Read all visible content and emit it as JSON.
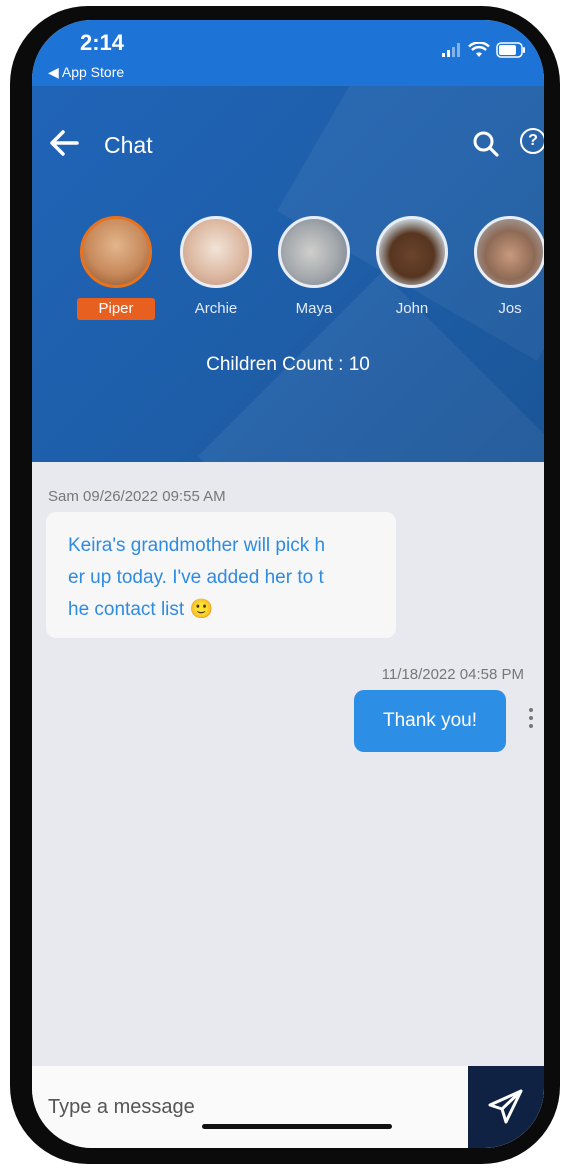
{
  "status_bar": {
    "time": "2:14",
    "back_app": "◀ App Store"
  },
  "header": {
    "title": "Chat",
    "children_count": "Children Count : 10"
  },
  "children": [
    {
      "name": "Piper",
      "selected": true,
      "avatar_colors": [
        "#d9a77a",
        "#a05b2c"
      ]
    },
    {
      "name": "Archie",
      "selected": false,
      "avatar_colors": [
        "#e7d7c9",
        "#c99b84"
      ]
    },
    {
      "name": "Maya",
      "selected": false,
      "avatar_colors": [
        "#b7b7b5",
        "#6e7d8f"
      ]
    },
    {
      "name": "John",
      "selected": false,
      "avatar_colors": [
        "#d8e3ea",
        "#5a3a25"
      ]
    },
    {
      "name": "Jos",
      "selected": false,
      "avatar_colors": [
        "#a9b6c6",
        "#7b5a45"
      ]
    }
  ],
  "messages": [
    {
      "direction": "incoming",
      "meta": "Sam 09/26/2022 09:55 AM",
      "lines": [
        "Keira's grandmother will pick h",
        "er up today. I've added her to t",
        "he contact list 🙂"
      ]
    },
    {
      "direction": "outgoing",
      "meta": "11/18/2022 04:58 PM",
      "text": "Thank you!"
    }
  ],
  "composer": {
    "placeholder": "Type a message"
  },
  "colors": {
    "header_blue": "#1e5ea8",
    "accent_orange": "#e8601f",
    "bubble_out": "#2d8ee6",
    "send_button": "#0f2244"
  },
  "icons": {
    "back": "arrow-left-icon",
    "search": "search-icon",
    "help": "help-icon",
    "send": "send-icon",
    "more": "kebab-menu-icon"
  }
}
